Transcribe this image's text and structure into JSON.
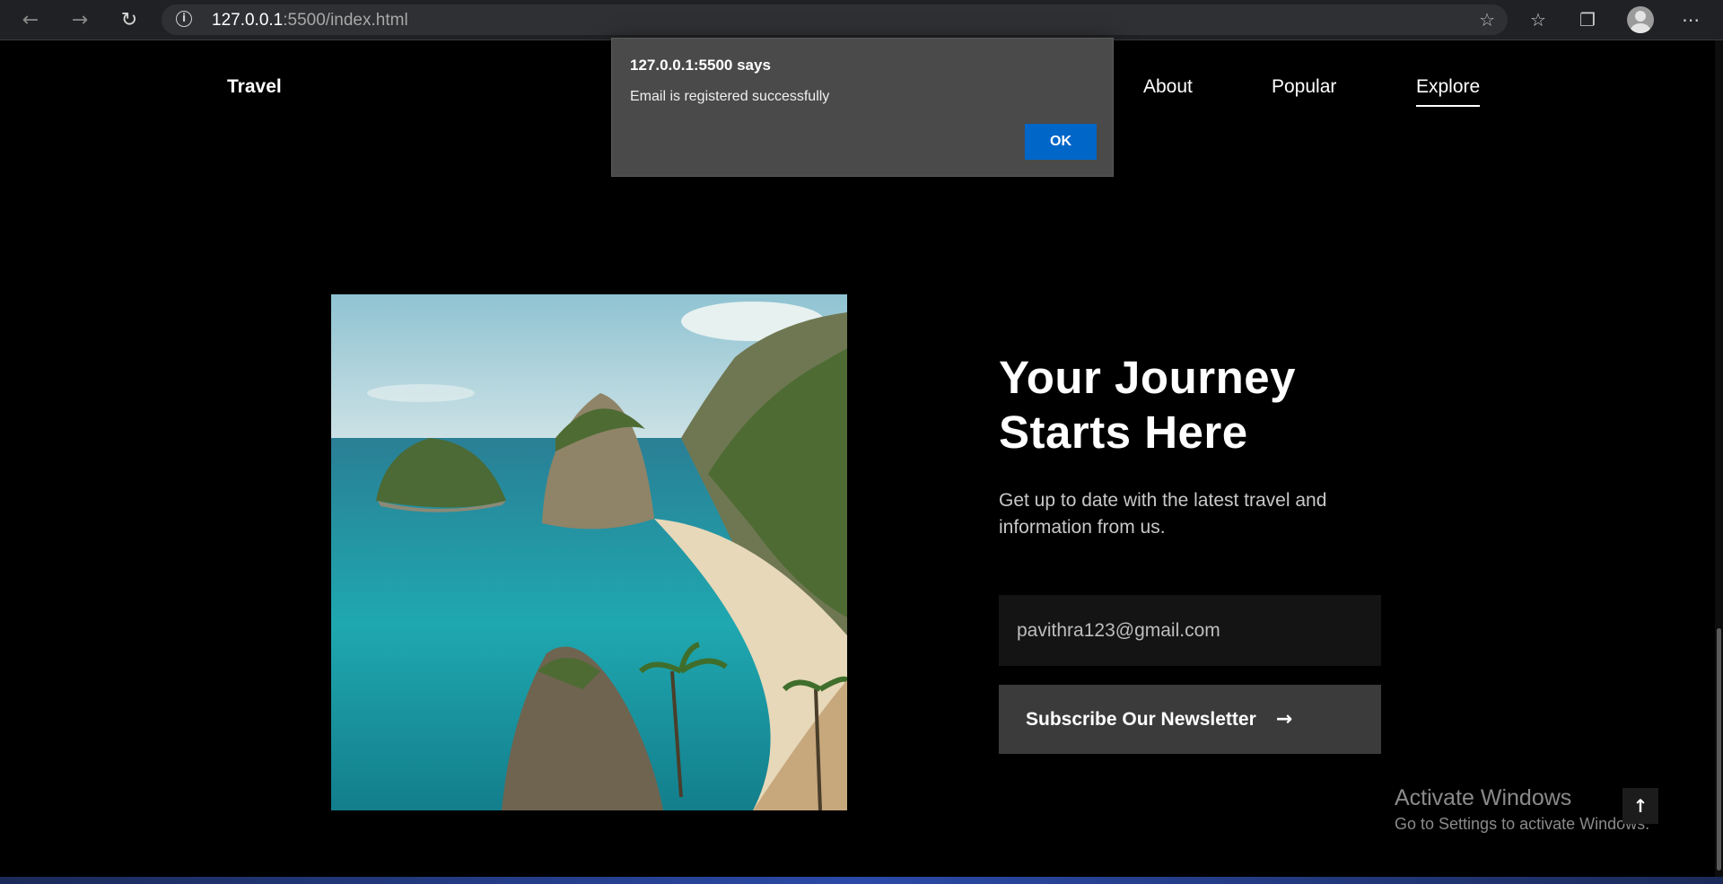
{
  "browser": {
    "url_host": "127.0.0.1",
    "url_rest": ":5500/index.html",
    "back_icon": "arrow-left-icon",
    "forward_icon": "arrow-right-icon",
    "refresh_icon": "refresh-icon",
    "info_icon": "info-icon",
    "toolbar_icons": [
      "add-favorite-icon",
      "favorites-icon",
      "collections-icon",
      "profile-icon",
      "more-icon"
    ]
  },
  "header": {
    "brand": "Travel",
    "nav": [
      {
        "label": "About",
        "current": false
      },
      {
        "label": "Popular",
        "current": false
      },
      {
        "label": "Explore",
        "current": true
      }
    ]
  },
  "hero": {
    "headline_line1": "Your Journey",
    "headline_line2": "Starts Here",
    "subtext": "Get up to date with the latest travel and information from us.",
    "email_value": "pavithra123@gmail.com",
    "subscribe_label": "Subscribe Our Newsletter",
    "subscribe_icon": "arrow-right-icon"
  },
  "alert": {
    "title": "127.0.0.1:5500 says",
    "message": "Email is registered successfully",
    "ok_label": "OK"
  },
  "watermark": {
    "title": "Activate Windows",
    "subtitle": "Go to Settings to activate Windows."
  },
  "colors": {
    "page_bg": "#000000",
    "button_bg": "#3b3b3b",
    "input_bg": "#141414",
    "alert_ok": "#0066c8"
  }
}
